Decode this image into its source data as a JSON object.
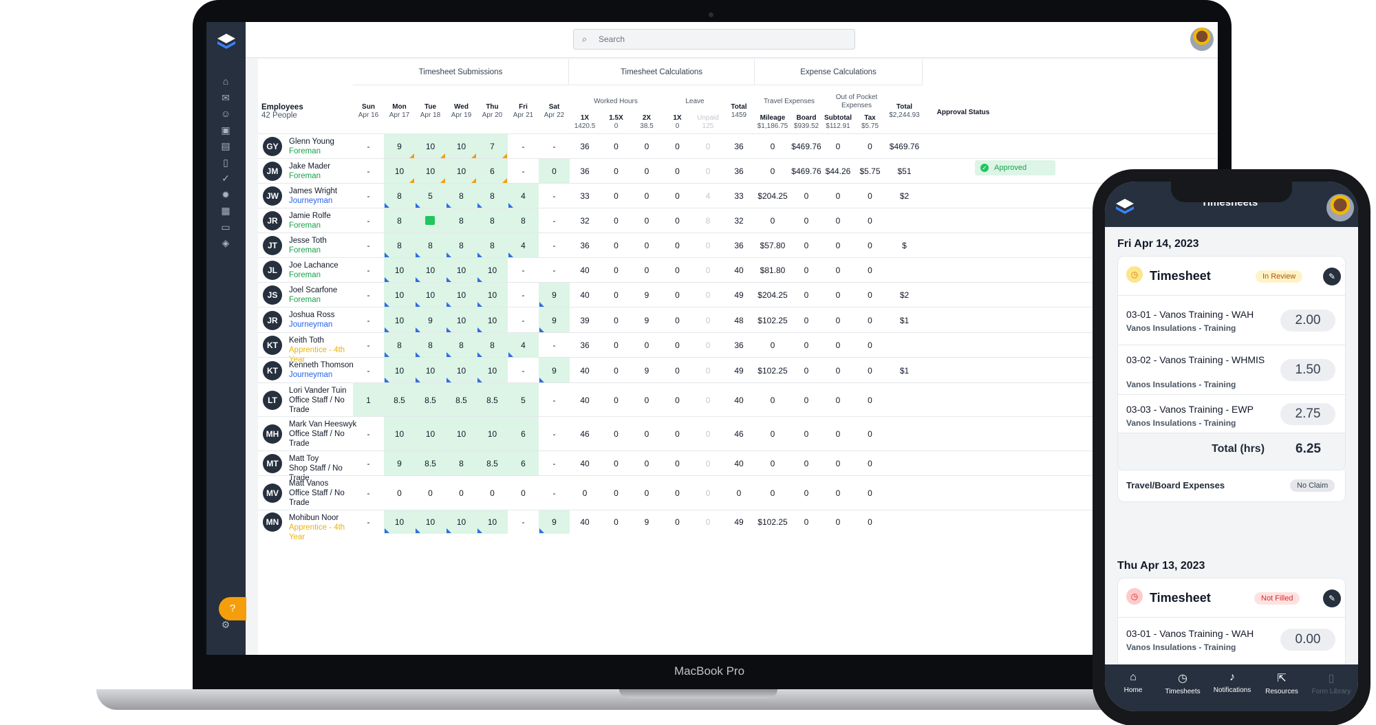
{
  "laptop": {
    "brand": "MacBook Pro",
    "search_placeholder": "Search",
    "sidebar_icons": [
      "home-icon",
      "mail-icon",
      "user-icon",
      "briefcase-icon",
      "folder-icon",
      "document-icon",
      "check-circle-icon",
      "lightbulb-icon",
      "calendar-icon",
      "credit-card-icon",
      "cube-icon"
    ],
    "help_icon": "question-icon",
    "settings_icon": "gear-icon",
    "groups": {
      "submissions": "Timesheet Submissions",
      "calculations": "Timesheet Calculations",
      "expenses": "Expense Calculations"
    },
    "subgroups": {
      "worked": "Worked Hours",
      "leave": "Leave",
      "travel": "Travel Expenses",
      "oop": "Out of Pocket Expenses"
    },
    "employees_header": "Employees",
    "employees_count": "42 People",
    "days": [
      {
        "d": "Sun",
        "date": "Apr 16"
      },
      {
        "d": "Mon",
        "date": "Apr 17"
      },
      {
        "d": "Tue",
        "date": "Apr 18"
      },
      {
        "d": "Wed",
        "date": "Apr 19"
      },
      {
        "d": "Thu",
        "date": "Apr 20"
      },
      {
        "d": "Fri",
        "date": "Apr 21"
      },
      {
        "d": "Sat",
        "date": "Apr 22"
      }
    ],
    "calc_cols": [
      {
        "h": "1X",
        "s": "1420.5"
      },
      {
        "h": "1.5X",
        "s": "0"
      },
      {
        "h": "2X",
        "s": "38.5"
      },
      {
        "h": "1X",
        "s": "0"
      },
      {
        "h": "Unpaid",
        "s": "125"
      },
      {
        "h": "Total",
        "s": "1459"
      }
    ],
    "exp_cols": [
      {
        "h": "Mileage",
        "s": "$1,186.75"
      },
      {
        "h": "Board",
        "s": "$939.52"
      },
      {
        "h": "Subtotal",
        "s": "$112.91"
      },
      {
        "h": "Tax",
        "s": "$5.75"
      },
      {
        "h": "Total",
        "s": "$2,244.93"
      }
    ],
    "approval_header": "Approval Status",
    "approved_label": "Approved",
    "rows": [
      {
        "i": "GY",
        "n": "Glenn Young",
        "r": "Foreman",
        "rc": "#16a34a",
        "days": [
          "-",
          "9",
          "10",
          "10",
          "7",
          "-",
          "-"
        ],
        "calc": [
          "36",
          "0",
          "0",
          "0",
          "0",
          "36"
        ],
        "exp": [
          "0",
          "$469.76",
          "0",
          "0",
          "$469.76"
        ]
      },
      {
        "i": "JM",
        "n": "Jake Mader",
        "r": "Foreman",
        "rc": "#16a34a",
        "days": [
          "-",
          "10",
          "10",
          "10",
          "6",
          "-",
          "0"
        ],
        "calc": [
          "36",
          "0",
          "0",
          "0",
          "0",
          "36"
        ],
        "exp": [
          "0",
          "$469.76",
          "$44.26",
          "$5.75",
          "$51"
        ]
      },
      {
        "i": "JW",
        "n": "James Wright",
        "r": "Journeyman",
        "rc": "#2563eb",
        "days": [
          "-",
          "8",
          "5",
          "8",
          "8",
          "4",
          "-"
        ],
        "calc": [
          "33",
          "0",
          "0",
          "0",
          "4",
          "33"
        ],
        "exp": [
          "$204.25",
          "0",
          "0",
          "0",
          "$2"
        ]
      },
      {
        "i": "JR",
        "n": "Jamie Rolfe",
        "r": "Foreman",
        "rc": "#16a34a",
        "days": [
          "-",
          "8",
          "",
          "8",
          "8",
          "8",
          "-"
        ],
        "calc": [
          "32",
          "0",
          "0",
          "0",
          "8",
          "32"
        ],
        "exp": [
          "0",
          "0",
          "0",
          "0",
          ""
        ]
      },
      {
        "i": "JT",
        "n": "Jesse Toth",
        "r": "Foreman",
        "rc": "#16a34a",
        "days": [
          "-",
          "8",
          "8",
          "8",
          "8",
          "4",
          "-"
        ],
        "calc": [
          "36",
          "0",
          "0",
          "0",
          "0",
          "36"
        ],
        "exp": [
          "$57.80",
          "0",
          "0",
          "0",
          "$"
        ]
      },
      {
        "i": "JL",
        "n": "Joe Lachance",
        "r": "Foreman",
        "rc": "#16a34a",
        "days": [
          "-",
          "10",
          "10",
          "10",
          "10",
          "-",
          "-"
        ],
        "calc": [
          "40",
          "0",
          "0",
          "0",
          "0",
          "40"
        ],
        "exp": [
          "$81.80",
          "0",
          "0",
          "0",
          ""
        ]
      },
      {
        "i": "JS",
        "n": "Joel Scarfone",
        "r": "Foreman",
        "rc": "#16a34a",
        "days": [
          "-",
          "10",
          "10",
          "10",
          "10",
          "-",
          "9"
        ],
        "calc": [
          "40",
          "0",
          "9",
          "0",
          "0",
          "49"
        ],
        "exp": [
          "$204.25",
          "0",
          "0",
          "0",
          "$2"
        ]
      },
      {
        "i": "JR",
        "n": "Joshua Ross",
        "r": "Journeyman",
        "rc": "#2563eb",
        "days": [
          "-",
          "10",
          "9",
          "10",
          "10",
          "-",
          "9"
        ],
        "calc": [
          "39",
          "0",
          "9",
          "0",
          "0",
          "48"
        ],
        "exp": [
          "$102.25",
          "0",
          "0",
          "0",
          "$1"
        ]
      },
      {
        "i": "KT",
        "n": "Keith Toth",
        "r": "Apprentice - 4th Year",
        "rc": "#eab308",
        "days": [
          "-",
          "8",
          "8",
          "8",
          "8",
          "4",
          "-"
        ],
        "calc": [
          "36",
          "0",
          "0",
          "0",
          "0",
          "36"
        ],
        "exp": [
          "0",
          "0",
          "0",
          "0",
          ""
        ]
      },
      {
        "i": "KT",
        "n": "Kenneth Thomson",
        "r": "Journeyman",
        "rc": "#2563eb",
        "days": [
          "-",
          "10",
          "10",
          "10",
          "10",
          "-",
          "9"
        ],
        "calc": [
          "40",
          "0",
          "9",
          "0",
          "0",
          "49"
        ],
        "exp": [
          "$102.25",
          "0",
          "0",
          "0",
          "$1"
        ]
      },
      {
        "i": "LT",
        "n": "Lori Vander Tuin",
        "r": "Office Staff / No Trade",
        "rc": "#111827",
        "days": [
          "1",
          "8.5",
          "8.5",
          "8.5",
          "8.5",
          "5",
          "-"
        ],
        "calc": [
          "40",
          "0",
          "0",
          "0",
          "0",
          "40"
        ],
        "exp": [
          "0",
          "0",
          "0",
          "0",
          ""
        ]
      },
      {
        "i": "MH",
        "n": "Mark Van Heeswyk",
        "r": "Office Staff / No Trade",
        "rc": "#111827",
        "days": [
          "-",
          "10",
          "10",
          "10",
          "10",
          "6",
          "-"
        ],
        "calc": [
          "46",
          "0",
          "0",
          "0",
          "0",
          "46"
        ],
        "exp": [
          "0",
          "0",
          "0",
          "0",
          ""
        ]
      },
      {
        "i": "MT",
        "n": "Matt Toy",
        "r": "Shop Staff / No Trade",
        "rc": "#111827",
        "days": [
          "-",
          "9",
          "8.5",
          "8",
          "8.5",
          "6",
          "-"
        ],
        "calc": [
          "40",
          "0",
          "0",
          "0",
          "0",
          "40"
        ],
        "exp": [
          "0",
          "0",
          "0",
          "0",
          ""
        ]
      },
      {
        "i": "MV",
        "n": "Matt Vanos",
        "r": "Office Staff / No Trade",
        "rc": "#111827",
        "days": [
          "-",
          "0",
          "0",
          "0",
          "0",
          "0",
          "-"
        ],
        "calc": [
          "0",
          "0",
          "0",
          "0",
          "0",
          "0"
        ],
        "exp": [
          "0",
          "0",
          "0",
          "0",
          ""
        ]
      },
      {
        "i": "MN",
        "n": "Mohibun Noor",
        "r": "Apprentice - 4th Year",
        "rc": "#eab308",
        "days": [
          "-",
          "10",
          "10",
          "10",
          "10",
          "-",
          "9"
        ],
        "calc": [
          "40",
          "0",
          "9",
          "0",
          "0",
          "49"
        ],
        "exp": [
          "$102.25",
          "0",
          "0",
          "0",
          ""
        ]
      }
    ]
  },
  "phone": {
    "title_partial": "Timesheets",
    "days": [
      {
        "date": "Fri Apr 14, 2023",
        "card_title": "Timesheet",
        "status": "In Review",
        "items": [
          {
            "name": "03-01 - Vanos Training - WAH",
            "sub": "Vanos Insulations - Training",
            "val": "2.00"
          },
          {
            "name": "03-02 - Vanos Training - WHMIS",
            "sub": "Vanos Insulations - Training",
            "val": "1.50"
          },
          {
            "name": "03-03 - Vanos Training - EWP",
            "sub": "Vanos Insulations - Training",
            "val": "2.75"
          }
        ],
        "total_label": "Total (hrs)",
        "total": "6.25",
        "expenses_label": "Travel/Board Expenses",
        "expenses_status": "No Claim"
      },
      {
        "date": "Thu Apr 13, 2023",
        "card_title": "Timesheet",
        "status": "Not Filled",
        "items": [
          {
            "name": "03-01 - Vanos Training - WAH",
            "sub": "Vanos Insulations - Training",
            "val": "0.00"
          }
        ]
      }
    ],
    "nav": [
      {
        "label": "Home",
        "icon": "home-icon"
      },
      {
        "label": "Timesheets",
        "icon": "clock-icon"
      },
      {
        "label": "Notifications",
        "icon": "bell-icon"
      },
      {
        "label": "Resources",
        "icon": "external-link-icon"
      },
      {
        "label": "Form Library",
        "icon": "clipboard-icon"
      }
    ]
  }
}
